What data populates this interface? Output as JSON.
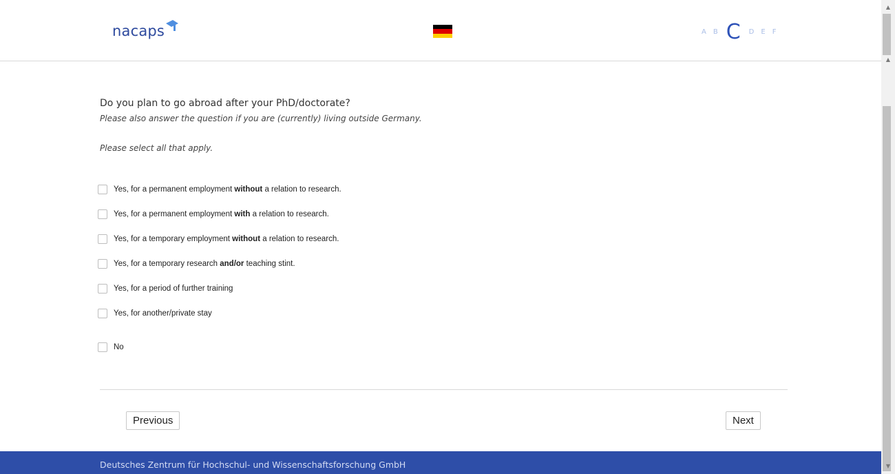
{
  "header": {
    "logo_text": "nacaps",
    "flag_colors": [
      "#000000",
      "#dd0000",
      "#ffce00"
    ],
    "steps": [
      {
        "label": "A",
        "active": false
      },
      {
        "label": "B",
        "active": false
      },
      {
        "label": "C",
        "active": true
      },
      {
        "label": "D",
        "active": false
      },
      {
        "label": "E",
        "active": false
      },
      {
        "label": "F",
        "active": false
      }
    ]
  },
  "question": {
    "title": "Do you plan to go abroad after your PhD/doctorate?",
    "note": "Please also answer the question if you are (currently) living outside Germany.",
    "instruction": "Please select all that apply."
  },
  "options": [
    {
      "before": "Yes, for a permanent employment ",
      "bold": "without",
      "after": " a relation to research.",
      "checked": false
    },
    {
      "before": "Yes, for a permanent employment ",
      "bold": "with",
      "after": " a relation to research.",
      "checked": false
    },
    {
      "before": "Yes, for a temporary employment ",
      "bold": "without",
      "after": " a relation to research.",
      "checked": false
    },
    {
      "before": "Yes, for a temporary research ",
      "bold": "and/or",
      "after": " teaching stint.",
      "checked": false
    },
    {
      "before": "Yes, for a period of further training",
      "bold": "",
      "after": "",
      "checked": false
    },
    {
      "before": "Yes, for another/private stay",
      "bold": "",
      "after": "",
      "checked": false
    },
    {
      "before": "No",
      "bold": "",
      "after": "",
      "checked": false
    }
  ],
  "nav": {
    "previous_label": "Previous",
    "next_label": "Next"
  },
  "footer": {
    "text": "Deutsches Zentrum für Hochschul- und Wissenschaftsforschung GmbH"
  },
  "colors": {
    "brand": "#2e4ea8",
    "step_active": "#2e52b8",
    "step_inactive": "#a9bde6"
  }
}
